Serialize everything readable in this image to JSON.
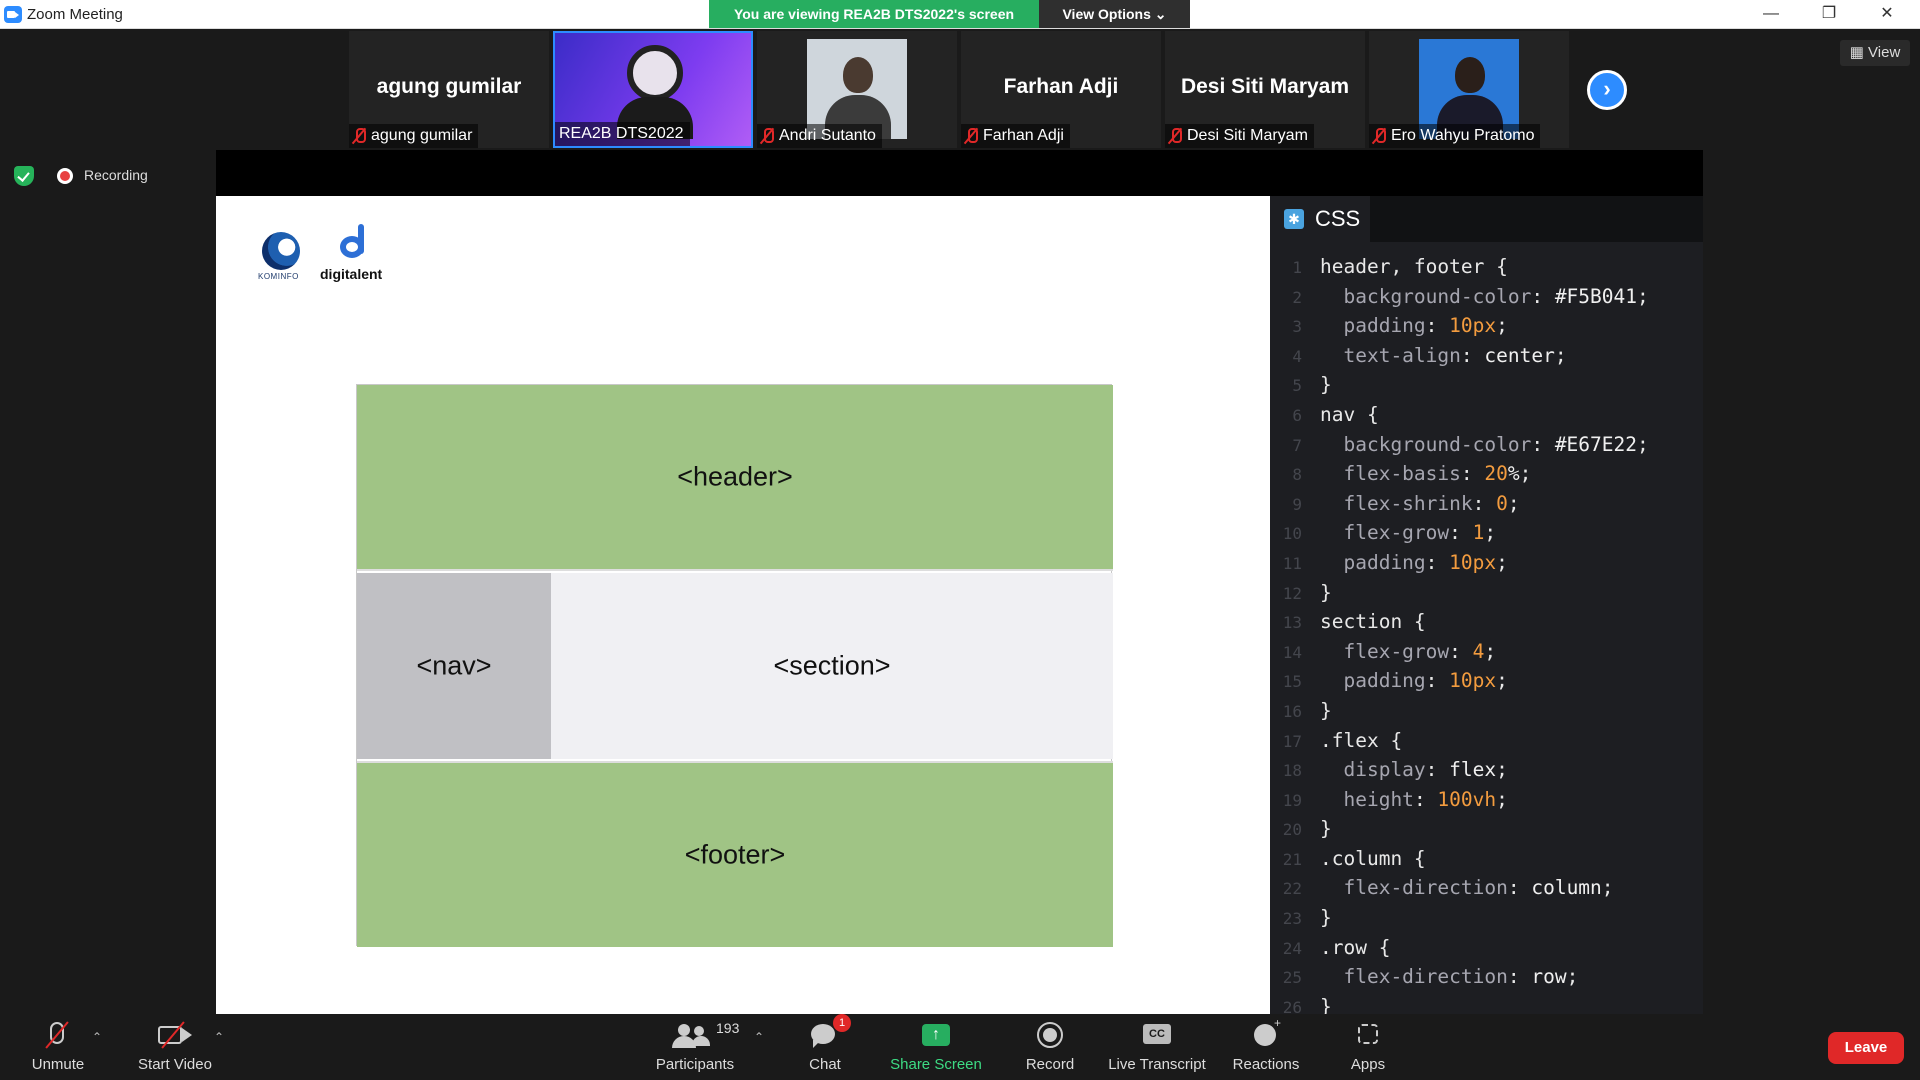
{
  "window": {
    "title": "Zoom Meeting",
    "share_banner": "You are viewing REA2B DTS2022's screen",
    "view_options": "View Options ⌄",
    "controls": {
      "minimize": "—",
      "restore": "❐",
      "close": "✕"
    }
  },
  "participants_strip": {
    "tiles": [
      {
        "big_name": "agung gumilar",
        "label": "agung gumilar",
        "muted": true
      },
      {
        "big_name": "",
        "label": "REA2B DTS2022",
        "muted": false,
        "active": true
      },
      {
        "big_name": "",
        "label": "Andri Sutanto",
        "muted": true
      },
      {
        "big_name": "Farhan Adji",
        "label": "Farhan Adji",
        "muted": true
      },
      {
        "big_name": "Desi Siti Maryam",
        "label": "Desi Siti Maryam",
        "muted": true
      },
      {
        "big_name": "",
        "label": "Ero Wahyu Pratomo",
        "muted": true
      }
    ],
    "next_icon": "chevron-right-icon",
    "view_label": "View"
  },
  "recording": {
    "label": "Recording"
  },
  "slide": {
    "logos": {
      "kominfo": "KOMINFO",
      "digitalent": "digitalent"
    },
    "layout": {
      "header": "<header>",
      "nav": "<nav>",
      "section": "<section>",
      "footer": "<footer>"
    },
    "colors": {
      "green": "#a0c485",
      "nav_gray": "#c0c0c4",
      "section_light": "#f0f0f3"
    }
  },
  "editor": {
    "tab_label": "CSS",
    "lines": [
      {
        "n": "1",
        "t": "header, footer {"
      },
      {
        "n": "2",
        "t": "  background-color: #F5B041;"
      },
      {
        "n": "3",
        "t": "  padding: 10px;"
      },
      {
        "n": "4",
        "t": "  text-align: center;"
      },
      {
        "n": "5",
        "t": "}"
      },
      {
        "n": "6",
        "t": "nav {"
      },
      {
        "n": "7",
        "t": "  background-color: #E67E22;"
      },
      {
        "n": "8",
        "t": "  flex-basis: 20%;"
      },
      {
        "n": "9",
        "t": "  flex-shrink: 0;"
      },
      {
        "n": "10",
        "t": "  flex-grow: 1;"
      },
      {
        "n": "11",
        "t": "  padding: 10px;"
      },
      {
        "n": "12",
        "t": "}"
      },
      {
        "n": "13",
        "t": "section {"
      },
      {
        "n": "14",
        "t": "  flex-grow: 4;"
      },
      {
        "n": "15",
        "t": "  padding: 10px;"
      },
      {
        "n": "16",
        "t": "}"
      },
      {
        "n": "17",
        "t": ".flex {"
      },
      {
        "n": "18",
        "t": "  display: flex;"
      },
      {
        "n": "19",
        "t": "  height: 100vh;"
      },
      {
        "n": "20",
        "t": "}"
      },
      {
        "n": "21",
        "t": ".column {"
      },
      {
        "n": "22",
        "t": "  flex-direction: column;"
      },
      {
        "n": "23",
        "t": "}"
      },
      {
        "n": "24",
        "t": ".row {"
      },
      {
        "n": "25",
        "t": "  flex-direction: row;"
      },
      {
        "n": "26",
        "t": "}"
      }
    ]
  },
  "toolbar": {
    "unmute": "Unmute",
    "start_video": "Start Video",
    "participants": "Participants",
    "participants_count": "193",
    "chat": "Chat",
    "chat_badge": "1",
    "share_screen": "Share Screen",
    "record": "Record",
    "live_transcript": "Live Transcript",
    "cc": "CC",
    "reactions": "Reactions",
    "apps": "Apps",
    "leave": "Leave"
  }
}
